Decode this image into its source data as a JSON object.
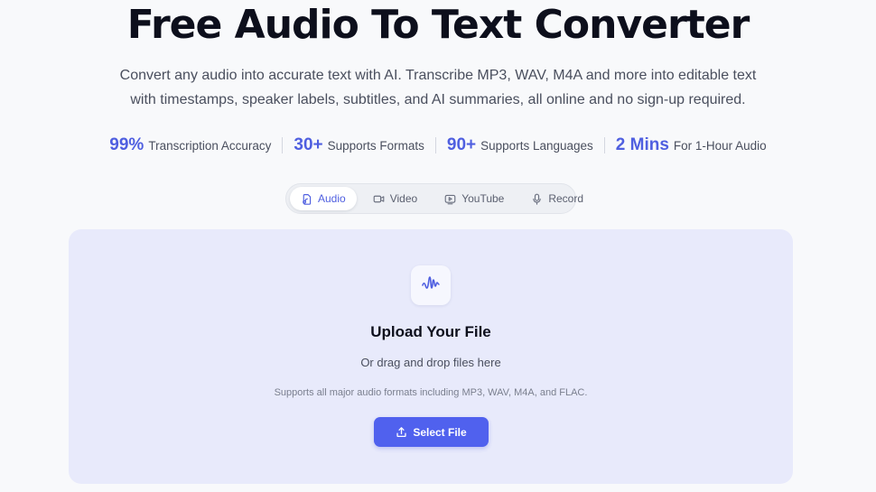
{
  "header": {
    "title": "Free Audio To Text Converter",
    "subtitle_line1": "Convert any audio into accurate text with AI. Transcribe MP3, WAV, M4A and more into editable text",
    "subtitle_line2": "with timestamps, speaker labels, subtitles, and AI summaries, all online and no sign-up required."
  },
  "stats": [
    {
      "value": "99%",
      "label": "Transcription Accuracy"
    },
    {
      "value": "30+",
      "label": "Supports Formats"
    },
    {
      "value": "90+",
      "label": "Supports Languages"
    },
    {
      "value": "2 Mins",
      "label": "For 1-Hour Audio"
    }
  ],
  "tabs": [
    {
      "label": "Audio",
      "icon": "audio-file-icon",
      "active": true
    },
    {
      "label": "Video",
      "icon": "video-camera-icon",
      "active": false
    },
    {
      "label": "YouTube",
      "icon": "youtube-icon",
      "active": false
    },
    {
      "label": "Record",
      "icon": "microphone-icon",
      "active": false
    }
  ],
  "upload": {
    "icon": "sound-wave-icon",
    "title": "Upload Your File",
    "subtitle": "Or drag and drop files here",
    "support_text": "Supports all major audio formats including MP3, WAV, M4A, and FLAC.",
    "button_label": "Select File",
    "button_icon": "upload-icon"
  },
  "colors": {
    "accent": "#4f5fe0",
    "button": "#5061ee",
    "card_bg": "#e8eafb",
    "page_bg": "#f8f9fb"
  }
}
